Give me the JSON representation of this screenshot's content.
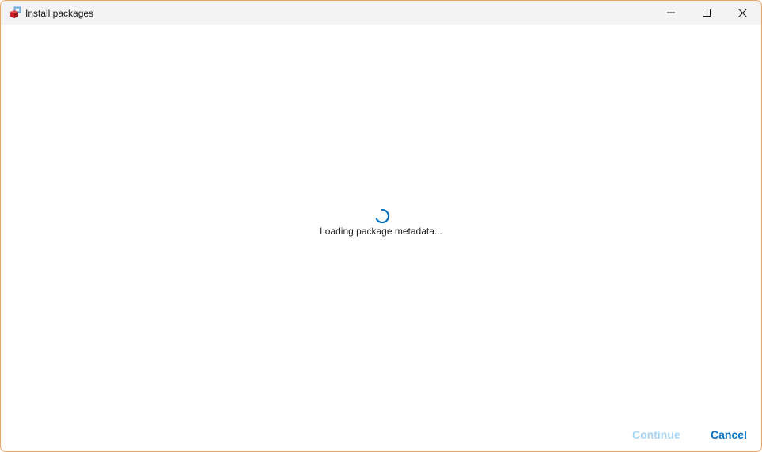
{
  "window": {
    "title": "Install packages",
    "app_icon": "package-app-icon",
    "controls": {
      "minimize_icon": "minimize-icon",
      "maximize_icon": "maximize-icon",
      "close_icon": "close-icon"
    }
  },
  "content": {
    "spinner_icon": "loading-spinner-icon",
    "loading_text": "Loading package metadata..."
  },
  "footer": {
    "continue_label": "Continue",
    "cancel_label": "Cancel"
  },
  "colors": {
    "accent": "#0a74c4",
    "accent_disabled": "#a9d6f3",
    "window_border": "#e8a66a",
    "titlebar_bg": "#f3f3f3"
  }
}
